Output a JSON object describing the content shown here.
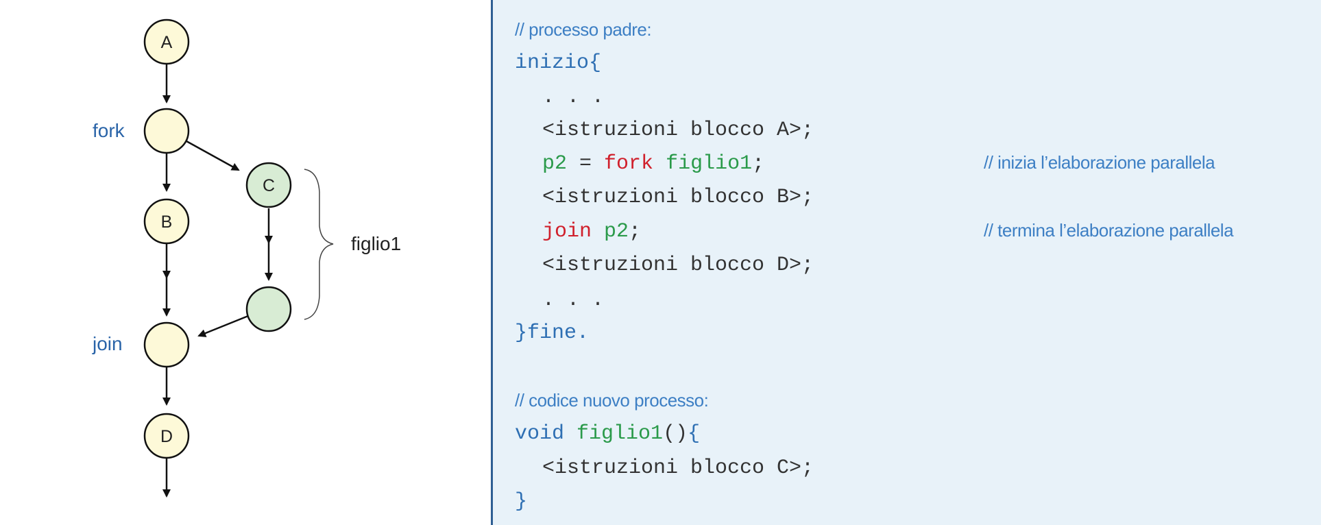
{
  "diagram": {
    "nodes": {
      "a": "A",
      "b": "B",
      "c": "C",
      "d": "D"
    },
    "labels": {
      "fork": "fork",
      "join": "join",
      "child": "figlio1"
    },
    "colors": {
      "main_node_fill": "#fdf9d8",
      "child_node_fill": "#d8ecd4",
      "label_blue": "#2a64a8"
    }
  },
  "code": {
    "comment_parent": "// processo padre:",
    "line_start_kw": "inizio",
    "line_start_brace": "{",
    "dots1": ". . .",
    "instr_a": "<istruzioni blocco A>;",
    "fork_var": "p2",
    "fork_eq": " = ",
    "fork_kw": "fork",
    "fork_target": "figlio1",
    "fork_semi": ";",
    "comment_fork": "// inizia l’elaborazione parallela",
    "instr_b": "<istruzioni blocco B>;",
    "join_kw": "join",
    "join_var": "p2",
    "join_semi": ";",
    "comment_join": "// termina l’elaborazione parallela",
    "instr_d": "<istruzioni blocco D>;",
    "dots2": ". . .",
    "end_brace": "}",
    "end_kw": "fine.",
    "comment_child": "// codice nuovo processo:",
    "child_type": "void",
    "child_name": "figlio1",
    "child_parens": "()",
    "child_brace": "{",
    "instr_c": "<istruzioni blocco C>;",
    "child_end_brace": "}"
  }
}
